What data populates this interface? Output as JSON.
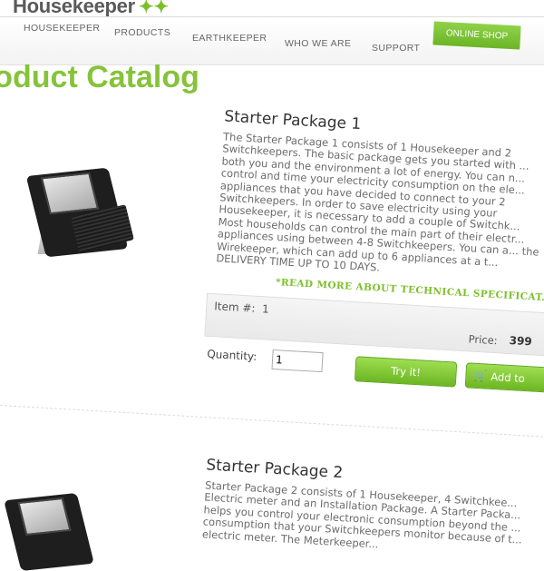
{
  "brand": {
    "name": "Housekeeper"
  },
  "nav": {
    "items": [
      "HOUSEKEEPER",
      "PRODUCTS",
      "EARTHKEEPER",
      "WHO WE ARE",
      "SUPPORT"
    ],
    "shop": "ONLINE SHOP"
  },
  "page": {
    "title": "roduct Catalog"
  },
  "product1": {
    "title": "Starter Package 1",
    "description": "The Starter Package 1 consists of 1 Housekeeper and 2 Switchkeepers. The basic package gets you started with ... both you and the environment a lot of energy. You can n... control and time your electricity consumption on the ele... appliances that you have decided to connect to your 2 Switchkeepers. In order to save electricity using your Housekeeper, it is necessary to add a couple of Switchk... Most households can control the main part of their electr... appliances using between 4-8 Switchkeepers. You can a... the Wirekeeper, which can add up to 6 appliances at a t... DELIVERY TIME UP TO 10 DAYS.",
    "read_more": "*READ MORE ABOUT TECHNICAL SPECIFICAT...",
    "item_label": "Item #:",
    "item_number": "1",
    "price_label": "Price:",
    "price_value": "399",
    "quantity_label": "Quantity:",
    "quantity_value": "1",
    "try_button": "Try it!",
    "add_button": "Add to"
  },
  "product2": {
    "title": "Starter Package 2",
    "description": "Starter Package 2 consists of 1 Housekeeper, 4 Switchkee... Electric meter and an Installation Package. A Starter Packa... helps you control your electronic consumption beyond the ... consumption that your Switchkeepers monitor because of t... electric meter. The Meterkeeper..."
  },
  "colors": {
    "accent_green": "#86c33a",
    "button_green": "#7cbf2a"
  }
}
